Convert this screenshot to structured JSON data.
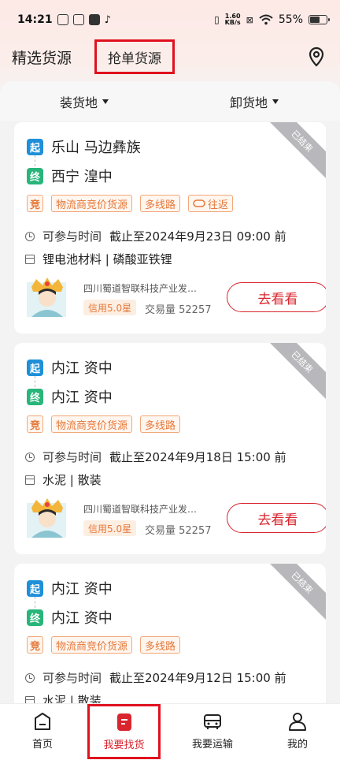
{
  "status_bar": {
    "time": "14:21",
    "net_speed_top": "1.60",
    "net_speed_bottom": "KB/s",
    "battery": "55%"
  },
  "header": {
    "tab_selected_source": "精选货源",
    "tab_grab_orders": "抢单货源",
    "location_icon": "location-pin-icon"
  },
  "filters": {
    "load_place": "装货地",
    "unload_place": "卸货地"
  },
  "cards": [
    {
      "status_ribbon": "已结束",
      "from_badge": "起",
      "to_badge": "终",
      "from": "乐山 马边彝族",
      "to": "西宁 湟中",
      "tags": [
        "竞",
        "物流商竞价货源",
        "多线路",
        "往返"
      ],
      "time_label": "可参与时间",
      "deadline": "截止至2024年9月23日 09:00 前",
      "goods": "锂电池材料 | 磷酸亚铁锂",
      "company": "四川蜀道智联科技产业发…",
      "credit": "信用5.0星",
      "volume": "交易量 52257",
      "button": "去看看"
    },
    {
      "status_ribbon": "已结束",
      "from_badge": "起",
      "to_badge": "终",
      "from": "内江 资中",
      "to": "内江 资中",
      "tags": [
        "竞",
        "物流商竞价货源",
        "多线路"
      ],
      "time_label": "可参与时间",
      "deadline": "截止至2024年9月18日 15:00 前",
      "goods": "水泥 | 散装",
      "company": "四川蜀道智联科技产业发…",
      "credit": "信用5.0星",
      "volume": "交易量 52257",
      "button": "去看看"
    },
    {
      "status_ribbon": "已结束",
      "from_badge": "起",
      "to_badge": "终",
      "from": "内江 资中",
      "to": "内江 资中",
      "tags": [
        "竞",
        "物流商竞价货源",
        "多线路"
      ],
      "time_label": "可参与时间",
      "deadline": "截止至2024年9月12日 15:00 前",
      "goods": "水泥 | 散装"
    }
  ],
  "bottom_nav": {
    "home": "首页",
    "find_goods": "我要找货",
    "transport": "我要运输",
    "mine": "我的"
  },
  "colors": {
    "accent_red": "#d9252e",
    "highlight_box": "#e0111f",
    "tag_orange": "#e5783a",
    "from_blue": "#1e8fd8",
    "to_green": "#28b57a"
  }
}
